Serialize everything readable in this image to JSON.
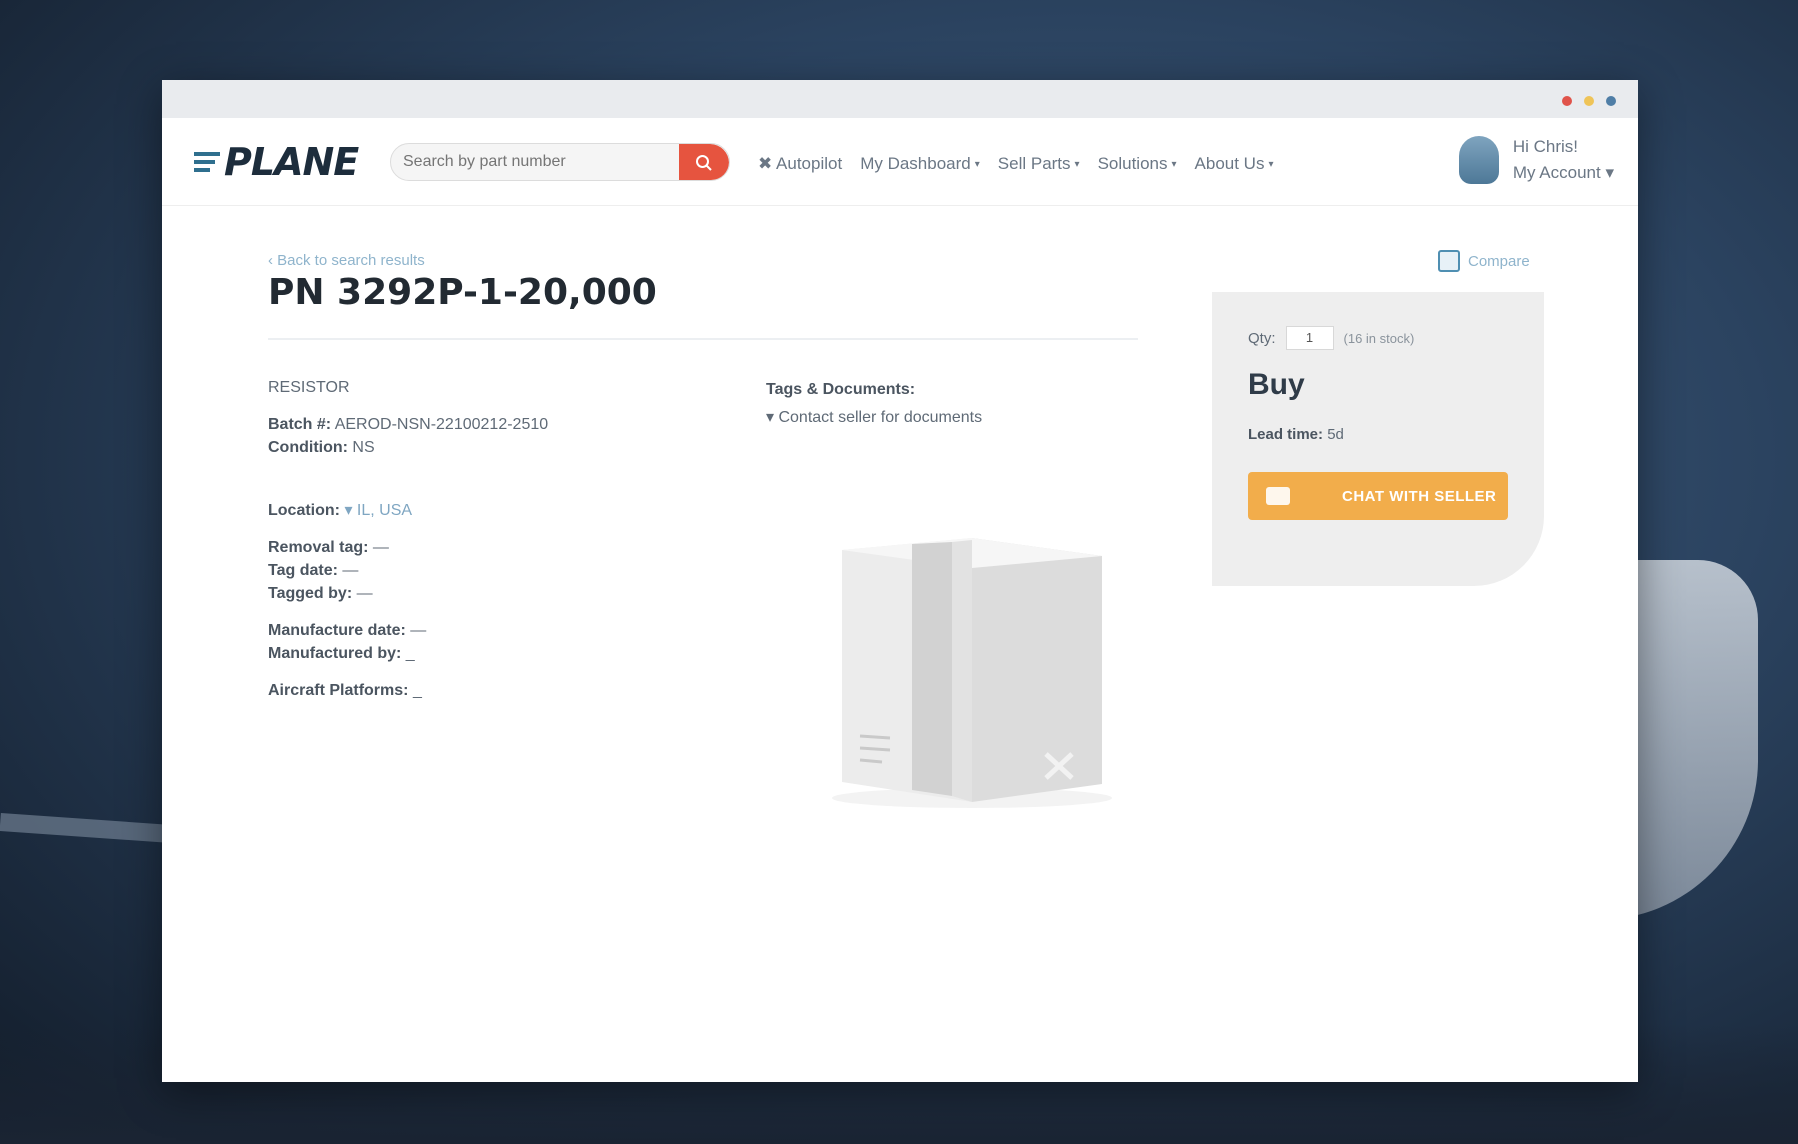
{
  "site": {
    "logo_text": "PLANE"
  },
  "search": {
    "placeholder": "Search by part number"
  },
  "nav": {
    "items": [
      {
        "label": "✖ Autopilot",
        "dropdown": false
      },
      {
        "label": "My Dashboard",
        "dropdown": true
      },
      {
        "label": "Sell Parts",
        "dropdown": true
      },
      {
        "label": "Solutions",
        "dropdown": true
      },
      {
        "label": "About Us",
        "dropdown": true
      }
    ],
    "caret": "▾"
  },
  "account": {
    "greeting": "Hi Chris!",
    "menu_label": "My Account ▾"
  },
  "page": {
    "back_link": "‹ Back to search results",
    "title": "PN 3292P-1-20,000",
    "compare_label": "Compare"
  },
  "details": {
    "category": "RESISTOR",
    "batch_label": "Batch #:",
    "batch_value": "AEROD-NSN-22100212-2510",
    "condition_label": "Condition:",
    "condition_value": "NS",
    "location_label": "Location:",
    "location_value": "▾ IL, USA",
    "removal_tag_label": "Removal tag:",
    "removal_tag_value": "—",
    "tag_date_label": "Tag date:",
    "tag_date_value": "—",
    "tagged_by_label": "Tagged by:",
    "tagged_by_value": "—",
    "manufacture_date_label": "Manufacture date:",
    "manufacture_date_value": "—",
    "manufactured_by_label": "Manufactured by:",
    "manufactured_by_value": "_",
    "aircraft_platforms_label": "Aircraft Platforms:",
    "aircraft_platforms_value": "_"
  },
  "tags": {
    "heading": "Tags & Documents:",
    "contact_text": "▾ Contact seller for documents"
  },
  "buy_box": {
    "qty_label": "Qty:",
    "qty_value": "1",
    "stock_text": "(16 in stock)",
    "heading": "Buy",
    "lead_label": "Lead time:",
    "lead_value": "5d",
    "chat_button": "CHAT WITH SELLER"
  },
  "colors": {
    "accent_orange": "#f2ad4b",
    "search_red": "#e6543f",
    "link_blue": "#7fa6c2"
  }
}
